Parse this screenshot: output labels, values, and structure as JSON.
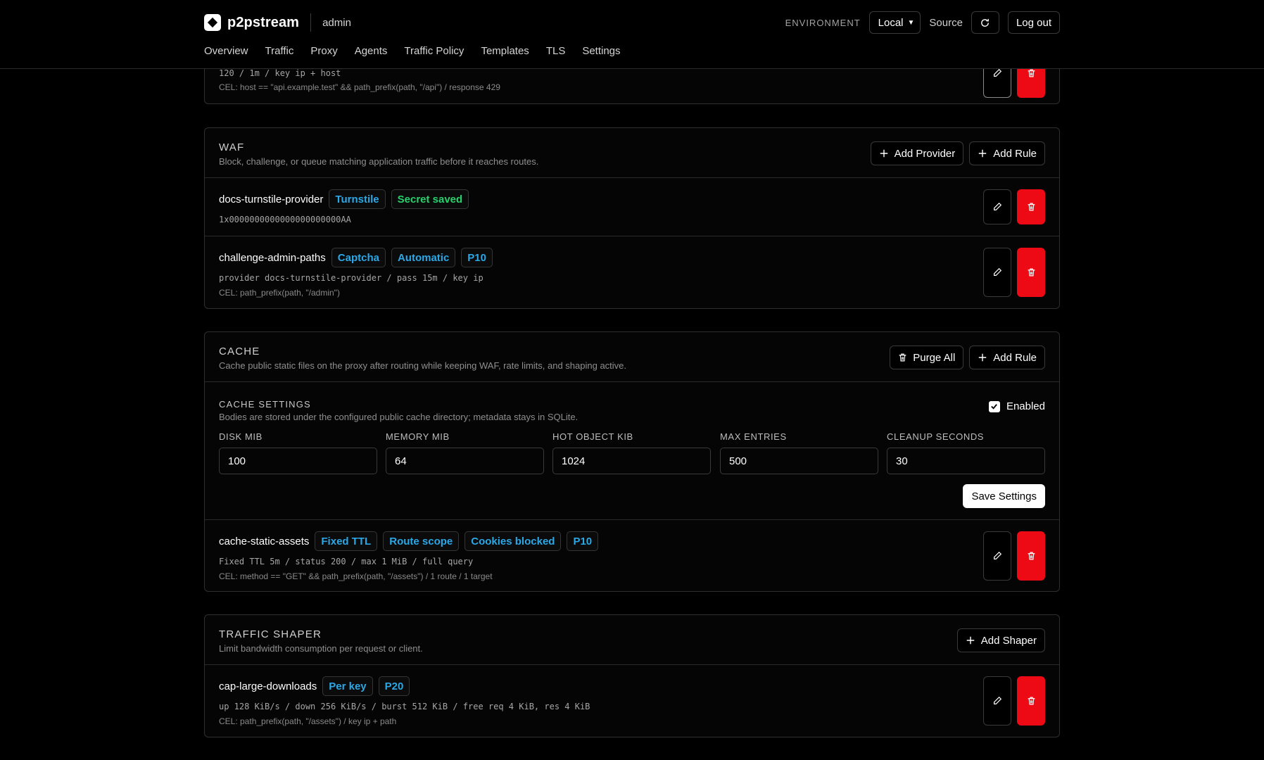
{
  "header": {
    "brand": "p2pstream",
    "user": "admin",
    "env_label": "ENVIRONMENT",
    "env_value": "Local",
    "source_label": "Source",
    "logout": "Log out"
  },
  "nav": [
    "Overview",
    "Traffic",
    "Proxy",
    "Agents",
    "Traffic Policy",
    "Templates",
    "TLS",
    "Settings"
  ],
  "rate_limit_partial": {
    "line": "120 / 1m / key ip + host",
    "cel": "CEL: host == \"api.example.test\" && path_prefix(path, \"/api\") / response 429"
  },
  "waf": {
    "title": "WAF",
    "description": "Block, challenge, or queue matching application traffic before it reaches routes.",
    "add_provider": "Add Provider",
    "add_rule": "Add Rule",
    "rows": [
      {
        "name": "docs-turnstile-provider",
        "badges": [
          "Turnstile",
          "Secret saved"
        ],
        "line": "1x0000000000000000000000AA",
        "cel": ""
      },
      {
        "name": "challenge-admin-paths",
        "badges": [
          "Captcha",
          "Automatic",
          "P10"
        ],
        "line": "provider docs-turnstile-provider / pass 15m / key ip",
        "cel": "CEL: path_prefix(path, \"/admin\")"
      }
    ]
  },
  "cache": {
    "title": "CACHE",
    "description": "Cache public static files on the proxy after routing while keeping WAF, rate limits, and shaping active.",
    "purge_all": "Purge All",
    "add_rule": "Add Rule",
    "settings": {
      "title": "CACHE SETTINGS",
      "description": "Bodies are stored under the configured public cache directory; metadata stays in SQLite.",
      "enabled_label": "Enabled",
      "fields": [
        {
          "label": "DISK MIB",
          "value": "100"
        },
        {
          "label": "MEMORY MIB",
          "value": "64"
        },
        {
          "label": "HOT OBJECT KIB",
          "value": "1024"
        },
        {
          "label": "MAX ENTRIES",
          "value": "500"
        },
        {
          "label": "CLEANUP SECONDS",
          "value": "30"
        }
      ],
      "save": "Save Settings"
    },
    "rows": [
      {
        "name": "cache-static-assets",
        "badges": [
          "Fixed TTL",
          "Route scope",
          "Cookies blocked",
          "P10"
        ],
        "line": "Fixed TTL 5m / status 200 / max 1 MiB / full query",
        "cel": "CEL: method == \"GET\" && path_prefix(path, \"/assets\") / 1 route / 1 target"
      }
    ]
  },
  "shaper": {
    "title": "TRAFFIC SHAPER",
    "description": "Limit bandwidth consumption per request or client.",
    "add_shaper": "Add Shaper",
    "rows": [
      {
        "name": "cap-large-downloads",
        "badges": [
          "Per key",
          "P20"
        ],
        "line": "up 128 KiB/s / down 256 KiB/s / burst 512 KiB / free req 4 KiB, res 4 KiB",
        "cel": "CEL: path_prefix(path, \"/assets\") / key ip + path"
      }
    ]
  },
  "icons": {
    "plus": "plus-icon",
    "edit": "pencil-icon",
    "delete": "trash-icon",
    "refresh": "refresh-icon",
    "purge": "trash-icon"
  },
  "colors": {
    "accent_blue": "#2aa8e8",
    "accent_green": "#29d16c",
    "danger": "#ee0a14"
  }
}
